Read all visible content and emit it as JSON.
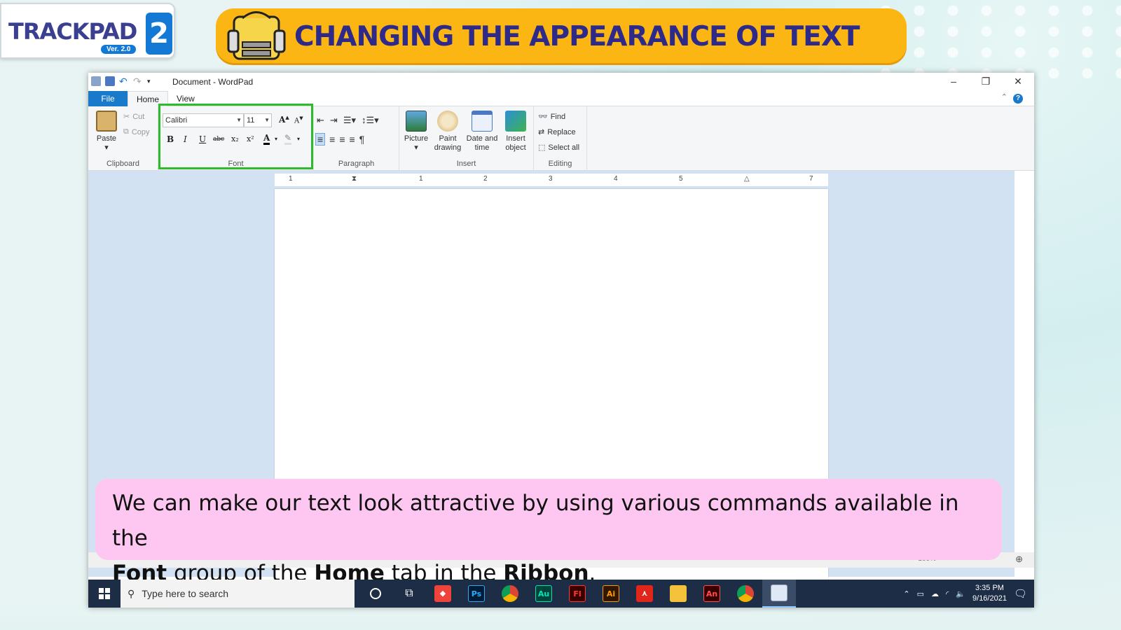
{
  "logo": {
    "brand": "TRACKPAD",
    "number": "2",
    "version": "Ver. 2.0"
  },
  "banner": {
    "title": "CHANGING THE APPEARANCE OF TEXT"
  },
  "window": {
    "title": "Document - WordPad",
    "controls": [
      "–",
      "❐",
      "✕"
    ]
  },
  "tabs": [
    "File",
    "Home",
    "View"
  ],
  "ribbon": {
    "clipboard": {
      "paste": "Paste",
      "cut": "Cut",
      "copy": "Copy",
      "label": "Clipboard"
    },
    "font": {
      "family": "Calibri",
      "size": "11",
      "label": "Font",
      "buttons": [
        "B",
        "I",
        "U",
        "abc",
        "x₂",
        "x²"
      ]
    },
    "paragraph": {
      "label": "Paragraph"
    },
    "insert": {
      "picture": "Picture",
      "paint_1": "Paint",
      "paint_2": "drawing",
      "datetime_1": "Date and",
      "datetime_2": "time",
      "object_1": "Insert",
      "object_2": "object",
      "label": "Insert"
    },
    "editing": {
      "find": "Find",
      "replace": "Replace",
      "select_all": "Select all",
      "label": "Editing"
    }
  },
  "ruler": [
    "1",
    "1",
    "2",
    "3",
    "4",
    "5",
    "7"
  ],
  "status": {
    "zoom": "100%"
  },
  "caption": {
    "line1": "We can make our text look attractive by using various commands available in the",
    "font": "Font",
    "mid1": " group of the ",
    "home": "Home",
    "mid2": " tab in the ",
    "ribbon": "Ribbon",
    "end": "."
  },
  "taskbar": {
    "search_placeholder": "Type here to search",
    "time": "3:35 PM",
    "date": "9/16/2021",
    "apps": [
      {
        "name": "Photoshop",
        "label": "Ps",
        "color": "#001d34"
      },
      {
        "name": "Audition",
        "label": "Au",
        "color": "#00453a"
      },
      {
        "name": "Flash",
        "label": "Fl",
        "color": "#3a0000"
      },
      {
        "name": "Illustrator",
        "label": "Ai",
        "color": "#2e1800"
      },
      {
        "name": "Animate",
        "label": "An",
        "color": "#3a0000"
      }
    ]
  },
  "colors": {
    "accent": "#1979ca",
    "banner": "#fbb614",
    "caption": "#fdc7f1",
    "highlight": "#2dbb2d"
  }
}
